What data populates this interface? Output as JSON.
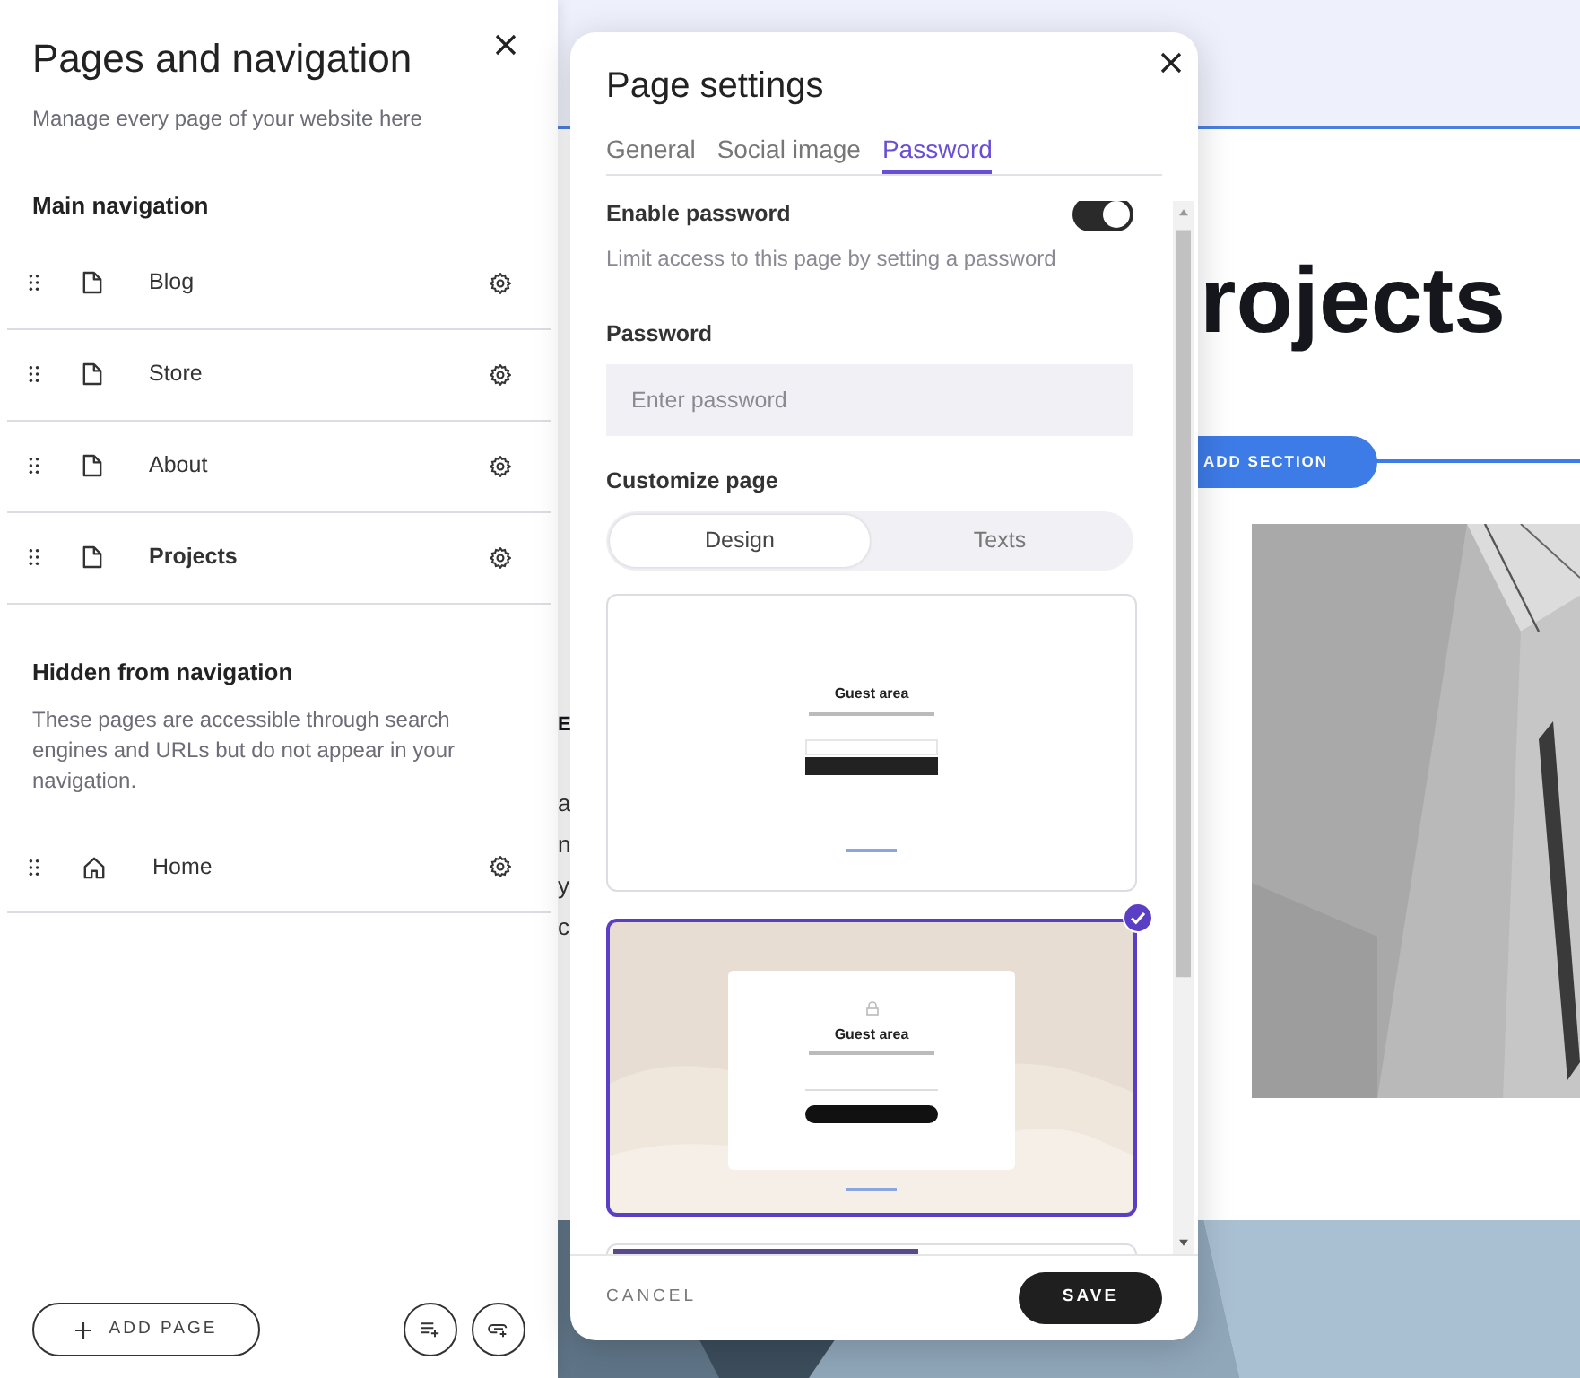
{
  "left_panel": {
    "title": "Pages and navigation",
    "subtitle": "Manage every page of your website here",
    "sections": [
      {
        "heading": "Main navigation",
        "pages": [
          {
            "label": "Blog",
            "kind": "page",
            "selected": false
          },
          {
            "label": "Store",
            "kind": "page",
            "selected": false
          },
          {
            "label": "About",
            "kind": "page",
            "selected": false
          },
          {
            "label": "Projects",
            "kind": "page",
            "selected": true
          }
        ]
      },
      {
        "heading": "Hidden from navigation",
        "description": "These pages are accessible through search engines and URLs but do not appear in your navigation.",
        "pages": [
          {
            "label": "Home",
            "kind": "home",
            "selected": false
          }
        ]
      }
    ],
    "add_page": "ADD PAGE"
  },
  "background_page": {
    "heading": "rojects",
    "add_section": "ADD SECTION",
    "fragments": [
      "E",
      "a",
      "n",
      "y",
      "c"
    ]
  },
  "dialog": {
    "title": "Page settings",
    "tabs": [
      {
        "label": "General",
        "selected": false
      },
      {
        "label": "Social image",
        "selected": false
      },
      {
        "label": "Password",
        "selected": true
      }
    ],
    "enable_password": {
      "label": "Enable password",
      "on": true,
      "description": "Limit access to this page by setting a password"
    },
    "password": {
      "label": "Password",
      "placeholder": "Enter password"
    },
    "customize": {
      "label": "Customize page",
      "segments": [
        {
          "label": "Design",
          "selected": true
        },
        {
          "label": "Texts",
          "selected": false
        }
      ]
    },
    "templates": [
      {
        "kind": "plain",
        "title": "Guest area",
        "selected": false
      },
      {
        "kind": "wave",
        "title": "Guest area",
        "selected": true
      },
      {
        "kind": "partial",
        "selected": false
      }
    ],
    "cancel": "CANCEL",
    "save": "SAVE"
  }
}
